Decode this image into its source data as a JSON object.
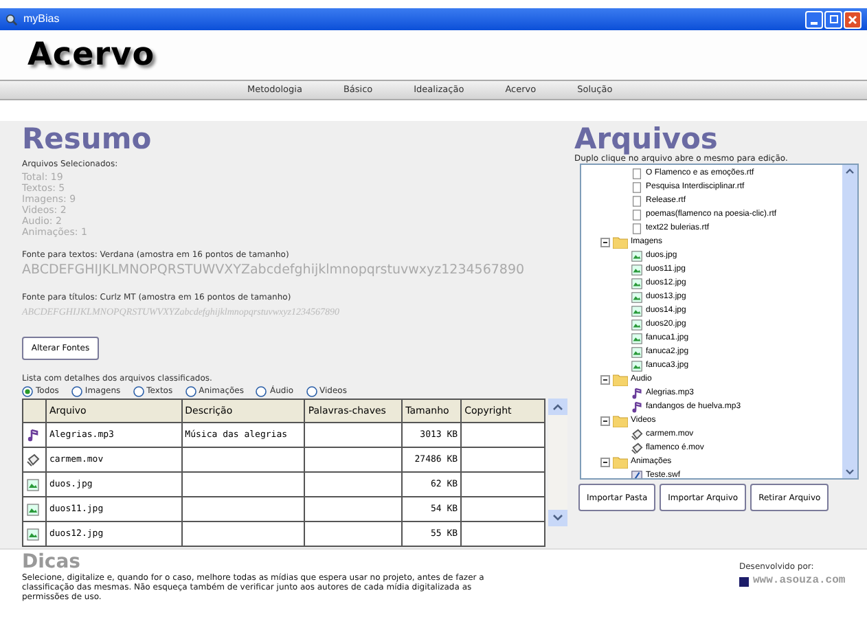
{
  "window": {
    "title": "myBias"
  },
  "header": {
    "logo": "Acervo"
  },
  "nav": [
    "Metodologia",
    "Básico",
    "Idealização",
    "Acervo",
    "Solução"
  ],
  "summary": {
    "title": "Resumo",
    "caption": "Arquivos Selecionados:",
    "counts": [
      "Total: 19",
      "Textos: 5",
      "Imagens: 9",
      "Videos: 2",
      "Audio: 2",
      "Animações: 1"
    ],
    "text_font_label": "Fonte para textos: Verdana (amostra em 16 pontos de tamanho)",
    "text_font_sample": "ABCDEFGHIJKLMNOPQRSTUWVXYZabcdefghijklmnopqrstuvwxyz1234567890",
    "title_font_label": "Fonte para títulos: Curlz MT (amostra em 16 pontos de tamanho)",
    "title_font_sample": "ABCDEFGHIJKLMNOPQRSTUWVXYZabcdefghijklmnopqrstuvwxyz1234567890",
    "change_fonts_button": "Alterar Fontes"
  },
  "list": {
    "caption": "Lista com detalhes dos arquivos classificados.",
    "filters": [
      {
        "label": "Todos",
        "selected": true
      },
      {
        "label": "Imagens",
        "selected": false
      },
      {
        "label": "Textos",
        "selected": false
      },
      {
        "label": "Animações",
        "selected": false
      },
      {
        "label": "Áudio",
        "selected": false
      },
      {
        "label": "Videos",
        "selected": false
      }
    ],
    "columns": [
      "Arquivo",
      "Descrição",
      "Palavras-chaves",
      "Tamanho",
      "Copyright"
    ],
    "rows": [
      {
        "kind": "audio",
        "file": "Alegrias.mp3",
        "description": "Música das alegrias",
        "size": "3013 KB"
      },
      {
        "kind": "video",
        "file": "carmem.mov",
        "size": "27486 KB"
      },
      {
        "kind": "image",
        "file": "duos.jpg",
        "size": "62 KB"
      },
      {
        "kind": "image",
        "file": "duos11.jpg",
        "size": "54 KB"
      },
      {
        "kind": "image",
        "file": "duos12.jpg",
        "size": "55 KB"
      }
    ]
  },
  "files": {
    "title": "Arquivos",
    "hint": "Duplo clique no arquivo abre o mesmo para edição.",
    "loose_items": [
      {
        "kind": "text",
        "label": "O Flamenco e as emoções.rtf"
      },
      {
        "kind": "text",
        "label": "Pesquisa Interdisciplinar.rtf"
      },
      {
        "kind": "text",
        "label": "Release.rtf"
      },
      {
        "kind": "text",
        "label": "poemas(flamenco na poesia-clic).rtf"
      },
      {
        "kind": "text",
        "label": "text22 bulerias.rtf"
      }
    ],
    "folders": [
      {
        "label": "Imagens",
        "expanded": true,
        "children": [
          {
            "kind": "image",
            "label": "duos.jpg"
          },
          {
            "kind": "image",
            "label": "duos11.jpg"
          },
          {
            "kind": "image",
            "label": "duos12.jpg"
          },
          {
            "kind": "image",
            "label": "duos13.jpg"
          },
          {
            "kind": "image",
            "label": "duos14.jpg"
          },
          {
            "kind": "image",
            "label": "duos20.jpg"
          },
          {
            "kind": "image",
            "label": "fanuca1.jpg"
          },
          {
            "kind": "image",
            "label": "fanuca2.jpg"
          },
          {
            "kind": "image",
            "label": "fanuca3.jpg"
          }
        ]
      },
      {
        "label": "Audio",
        "expanded": true,
        "children": [
          {
            "kind": "audio",
            "label": "Alegrias.mp3"
          },
          {
            "kind": "audio",
            "label": "fandangos de huelva.mp3"
          }
        ]
      },
      {
        "label": "Videos",
        "expanded": true,
        "children": [
          {
            "kind": "video",
            "label": "carmem.mov"
          },
          {
            "kind": "video",
            "label": "flamenco é.mov"
          }
        ]
      },
      {
        "label": "Animações",
        "expanded": true,
        "children": [
          {
            "kind": "animation",
            "label": "Teste.swf"
          }
        ]
      }
    ],
    "buttons": [
      "Importar Pasta",
      "Importar Arquivo",
      "Retirar Arquivo"
    ]
  },
  "tips": {
    "title": "Dicas",
    "text": "Selecione, digitalize e, quando for o caso, melhore todas as mídias que espera usar no projeto, antes de fazer a classificação das mesmas. Não esqueça também de verificar junto aos autores de cada mídia digitalizada as permissões de uso."
  },
  "credit": {
    "label": "Desenvolvido por:",
    "site": "www.asouza.com"
  }
}
